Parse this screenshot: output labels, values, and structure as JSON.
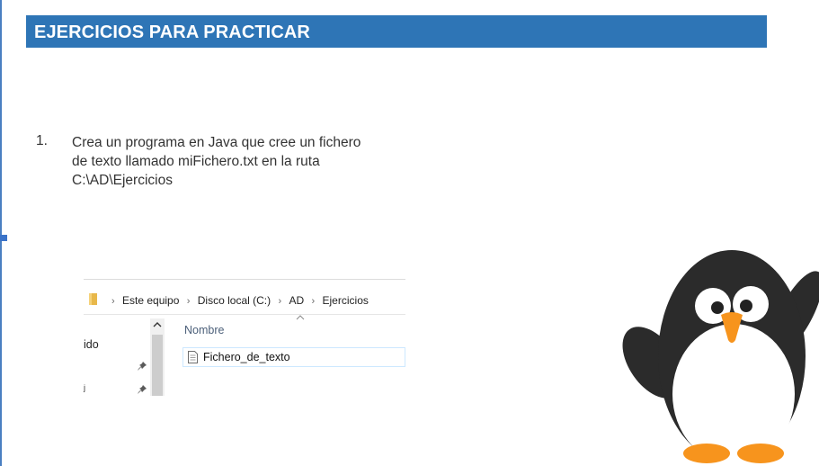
{
  "slide": {
    "title": "EJERCICIOS PARA PRACTICAR",
    "title_bar_color": "#2e75b6",
    "exercise": {
      "number": "1.",
      "lines": [
        "Crea un programa en Java que cree un fichero",
        "de texto llamado miFichero.txt en la ruta",
        "C:\\AD\\Ejercicios"
      ]
    }
  },
  "explorer": {
    "breadcrumb": [
      "Este equipo",
      "Disco local (C:)",
      "AD",
      "Ejercicios"
    ],
    "breadcrumb_separator": "›",
    "nav_pane": {
      "item_1": "ido",
      "item_2": "ʲ"
    },
    "column_header": "Nombre",
    "files": [
      {
        "name": "Fichero_de_texto",
        "icon": "text-file-icon"
      }
    ],
    "icons": [
      "folder-icon",
      "pin-icon",
      "chevron-up-icon",
      "sort-caret-icon"
    ]
  },
  "illustration": {
    "icon": "penguin-mascot"
  }
}
